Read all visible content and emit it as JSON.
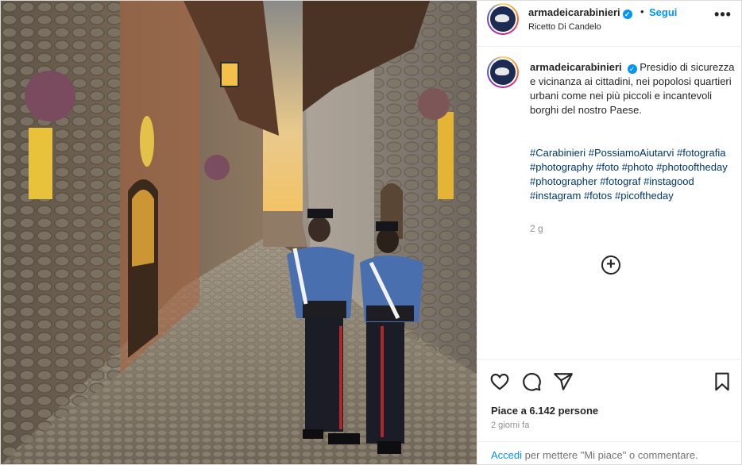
{
  "post": {
    "username": "armadeicarabinieri",
    "follow_label": "Segui",
    "separator": "•",
    "location": "Ricetto Di Candelo",
    "more_label": "•••"
  },
  "caption": {
    "username": "armadeicarabinieri",
    "text": "Presidio di sicurezza e vicinanza ai cittadini, nei popolosi quartieri urbani come nei più piccoli e incantevoli borghi del nostro Paese.",
    "hashtags": [
      "#Carabinieri",
      "#PossiamoAiutarvi",
      "#fotografia",
      "#photography",
      "#foto",
      "#photo",
      "#photooftheday",
      "#photographer",
      "#fotograf",
      "#instagood",
      "#instagram",
      "#fotos",
      "#picoftheday"
    ],
    "time_short": "2 g"
  },
  "actions": {
    "like_icon": "heart-icon",
    "comment_icon": "comment-icon",
    "share_icon": "share-icon",
    "save_icon": "bookmark-icon",
    "load_more_icon": "plus-circle-icon"
  },
  "stats": {
    "likes": "Piace a 6.142 persone",
    "time_long": "2 giorni fa"
  },
  "footer": {
    "login": "Accedi",
    "rest": " per mettere \"Mi piace\" o commentare."
  },
  "colors": {
    "accent": "#0095f6",
    "hashtag": "#00376b",
    "text": "#262626",
    "muted": "#8e8e8e"
  }
}
